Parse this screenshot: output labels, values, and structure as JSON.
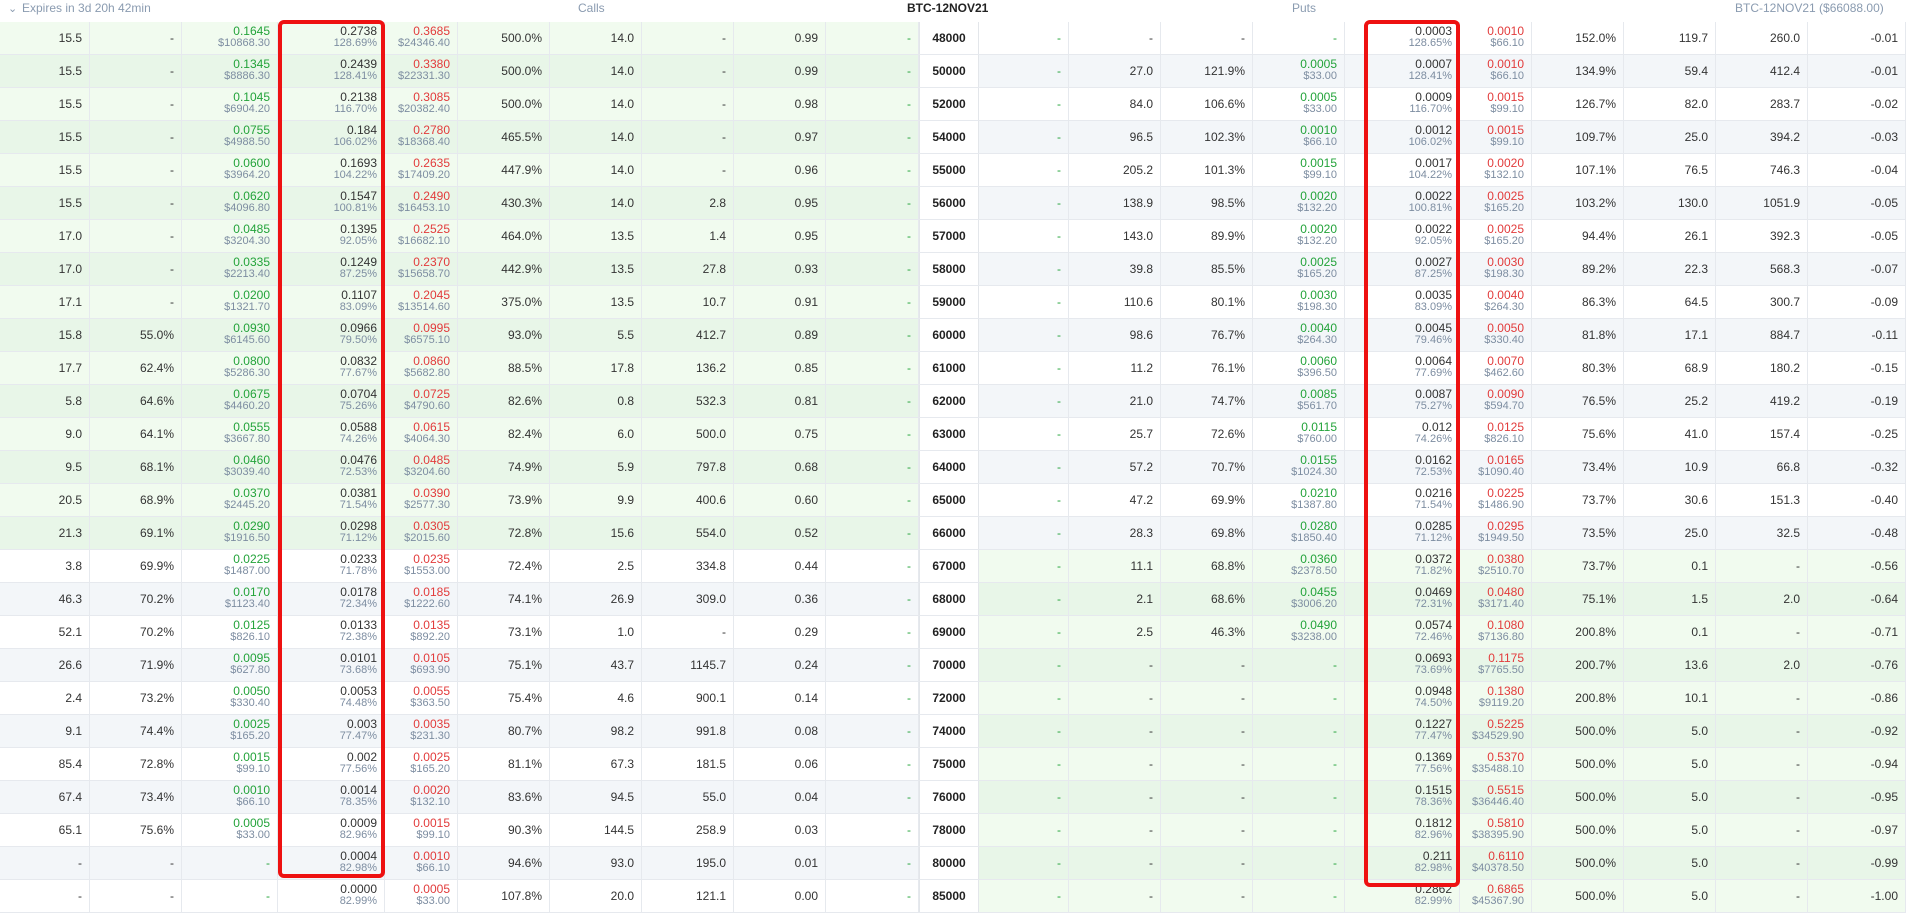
{
  "header": {
    "expiry": "Expires in 3d 20h 42min",
    "calls": "Calls",
    "instrument": "BTC-12NOV21",
    "puts": "Puts",
    "right": "BTC-12NOV21 ($66088.00)"
  },
  "icons": {
    "collapse": "chevron-down-icon"
  },
  "colors": {
    "bid": "#23a33a",
    "ask": "#e23b3b",
    "highlight": "#ee1111",
    "itm_background": "#f1fbef"
  },
  "rows": [
    {
      "strike": "48000",
      "call_itm": true,
      "put_itm": false,
      "call": [
        "15.5",
        "-",
        "0.1645",
        "$10868.30",
        "0.2738",
        "128.69%",
        "0.3685",
        "$24346.40",
        "500.0%",
        "14.0",
        "-",
        "0.99",
        "-"
      ],
      "put": [
        "-",
        "-",
        "-",
        "-",
        "0.0003",
        "128.65%",
        "0.0010",
        "$66.10",
        "152.0%",
        "119.7",
        "260.0",
        "-0.01"
      ]
    },
    {
      "strike": "50000",
      "call_itm": true,
      "put_itm": false,
      "call": [
        "15.5",
        "-",
        "0.1345",
        "$8886.30",
        "0.2439",
        "128.41%",
        "0.3380",
        "$22331.30",
        "500.0%",
        "14.0",
        "-",
        "0.99",
        "-"
      ],
      "put": [
        "-",
        "27.0",
        "121.9%",
        "0.0005",
        "$33.00",
        "0.0007",
        "128.41%",
        "0.0010",
        "$66.10",
        "134.9%",
        "59.4",
        "412.4",
        "-0.01"
      ]
    },
    {
      "strike": "52000",
      "call_itm": true,
      "put_itm": false,
      "call": [
        "15.5",
        "-",
        "0.1045",
        "$6904.20",
        "0.2138",
        "116.70%",
        "0.3085",
        "$20382.40",
        "500.0%",
        "14.0",
        "-",
        "0.98",
        "-"
      ],
      "put": [
        "-",
        "84.0",
        "106.6%",
        "0.0005",
        "$33.00",
        "0.0009",
        "116.70%",
        "0.0015",
        "$99.10",
        "126.7%",
        "82.0",
        "283.7",
        "-0.02"
      ]
    },
    {
      "strike": "54000",
      "call_itm": true,
      "put_itm": false,
      "call": [
        "15.5",
        "-",
        "0.0755",
        "$4988.50",
        "0.184",
        "106.02%",
        "0.2780",
        "$18368.40",
        "465.5%",
        "14.0",
        "-",
        "0.97",
        "-"
      ],
      "put": [
        "-",
        "96.5",
        "102.3%",
        "0.0010",
        "$66.10",
        "0.0012",
        "106.02%",
        "0.0015",
        "$99.10",
        "109.7%",
        "25.0",
        "394.2",
        "-0.03"
      ]
    },
    {
      "strike": "55000",
      "call_itm": true,
      "put_itm": false,
      "call": [
        "15.5",
        "-",
        "0.0600",
        "$3964.20",
        "0.1693",
        "104.22%",
        "0.2635",
        "$17409.20",
        "447.9%",
        "14.0",
        "-",
        "0.96",
        "-"
      ],
      "put": [
        "-",
        "205.2",
        "101.3%",
        "0.0015",
        "$99.10",
        "0.0017",
        "104.22%",
        "0.0020",
        "$132.10",
        "107.1%",
        "76.5",
        "746.3",
        "-0.04"
      ]
    },
    {
      "strike": "56000",
      "call_itm": true,
      "put_itm": false,
      "call": [
        "15.5",
        "-",
        "0.0620",
        "$4096.80",
        "0.1547",
        "100.81%",
        "0.2490",
        "$16453.10",
        "430.3%",
        "14.0",
        "2.8",
        "0.95",
        "-"
      ],
      "put": [
        "-",
        "138.9",
        "98.5%",
        "0.0020",
        "$132.20",
        "0.0022",
        "100.81%",
        "0.0025",
        "$165.20",
        "103.2%",
        "130.0",
        "1051.9",
        "-0.05"
      ]
    },
    {
      "strike": "57000",
      "call_itm": true,
      "put_itm": false,
      "call": [
        "17.0",
        "-",
        "0.0485",
        "$3204.30",
        "0.1395",
        "92.05%",
        "0.2525",
        "$16682.10",
        "464.0%",
        "13.5",
        "1.4",
        "0.95",
        "-"
      ],
      "put": [
        "-",
        "143.0",
        "89.9%",
        "0.0020",
        "$132.20",
        "0.0022",
        "92.05%",
        "0.0025",
        "$165.20",
        "94.4%",
        "26.1",
        "392.3",
        "-0.05"
      ]
    },
    {
      "strike": "58000",
      "call_itm": true,
      "put_itm": false,
      "call": [
        "17.0",
        "-",
        "0.0335",
        "$2213.40",
        "0.1249",
        "87.25%",
        "0.2370",
        "$15658.70",
        "442.9%",
        "13.5",
        "27.8",
        "0.93",
        "-"
      ],
      "put": [
        "-",
        "39.8",
        "85.5%",
        "0.0025",
        "$165.20",
        "0.0027",
        "87.25%",
        "0.0030",
        "$198.30",
        "89.2%",
        "22.3",
        "568.3",
        "-0.07"
      ]
    },
    {
      "strike": "59000",
      "call_itm": true,
      "put_itm": false,
      "call": [
        "17.1",
        "-",
        "0.0200",
        "$1321.70",
        "0.1107",
        "83.09%",
        "0.2045",
        "$13514.60",
        "375.0%",
        "13.5",
        "10.7",
        "0.91",
        "-"
      ],
      "put": [
        "-",
        "110.6",
        "80.1%",
        "0.0030",
        "$198.30",
        "0.0035",
        "83.09%",
        "0.0040",
        "$264.30",
        "86.3%",
        "64.5",
        "300.7",
        "-0.09"
      ]
    },
    {
      "strike": "60000",
      "call_itm": true,
      "put_itm": false,
      "call": [
        "15.8",
        "55.0%",
        "0.0930",
        "$6145.60",
        "0.0966",
        "79.50%",
        "0.0995",
        "$6575.10",
        "93.0%",
        "5.5",
        "412.7",
        "0.89",
        "-"
      ],
      "put": [
        "-",
        "98.6",
        "76.7%",
        "0.0040",
        "$264.30",
        "0.0045",
        "79.46%",
        "0.0050",
        "$330.40",
        "81.8%",
        "17.1",
        "884.7",
        "-0.11"
      ]
    },
    {
      "strike": "61000",
      "call_itm": true,
      "put_itm": false,
      "call": [
        "17.7",
        "62.4%",
        "0.0800",
        "$5286.30",
        "0.0832",
        "77.67%",
        "0.0860",
        "$5682.80",
        "88.5%",
        "17.8",
        "136.2",
        "0.85",
        "-"
      ],
      "put": [
        "-",
        "11.2",
        "76.1%",
        "0.0060",
        "$396.50",
        "0.0064",
        "77.69%",
        "0.0070",
        "$462.60",
        "80.3%",
        "68.9",
        "180.2",
        "-0.15"
      ]
    },
    {
      "strike": "62000",
      "call_itm": true,
      "put_itm": false,
      "call": [
        "5.8",
        "64.6%",
        "0.0675",
        "$4460.20",
        "0.0704",
        "75.26%",
        "0.0725",
        "$4790.60",
        "82.6%",
        "0.8",
        "532.3",
        "0.81",
        "-"
      ],
      "put": [
        "-",
        "21.0",
        "74.7%",
        "0.0085",
        "$561.70",
        "0.0087",
        "75.27%",
        "0.0090",
        "$594.70",
        "76.5%",
        "25.2",
        "419.2",
        "-0.19"
      ]
    },
    {
      "strike": "63000",
      "call_itm": true,
      "put_itm": false,
      "call": [
        "9.0",
        "64.1%",
        "0.0555",
        "$3667.80",
        "0.0588",
        "74.26%",
        "0.0615",
        "$4064.30",
        "82.4%",
        "6.0",
        "500.0",
        "0.75",
        "-"
      ],
      "put": [
        "-",
        "25.7",
        "72.6%",
        "0.0115",
        "$760.00",
        "0.012",
        "74.26%",
        "0.0125",
        "$826.10",
        "75.6%",
        "41.0",
        "157.4",
        "-0.25"
      ]
    },
    {
      "strike": "64000",
      "call_itm": true,
      "put_itm": false,
      "call": [
        "9.5",
        "68.1%",
        "0.0460",
        "$3039.40",
        "0.0476",
        "72.53%",
        "0.0485",
        "$3204.60",
        "74.9%",
        "5.9",
        "797.8",
        "0.68",
        "-"
      ],
      "put": [
        "-",
        "57.2",
        "70.7%",
        "0.0155",
        "$1024.30",
        "0.0162",
        "72.53%",
        "0.0165",
        "$1090.40",
        "73.4%",
        "10.9",
        "66.8",
        "-0.32"
      ]
    },
    {
      "strike": "65000",
      "call_itm": true,
      "put_itm": false,
      "call": [
        "20.5",
        "68.9%",
        "0.0370",
        "$2445.20",
        "0.0381",
        "71.54%",
        "0.0390",
        "$2577.30",
        "73.9%",
        "9.9",
        "400.6",
        "0.60",
        "-"
      ],
      "put": [
        "-",
        "47.2",
        "69.9%",
        "0.0210",
        "$1387.80",
        "0.0216",
        "71.54%",
        "0.0225",
        "$1486.90",
        "73.7%",
        "30.6",
        "151.3",
        "-0.40"
      ]
    },
    {
      "strike": "66000",
      "call_itm": true,
      "put_itm": false,
      "call": [
        "21.3",
        "69.1%",
        "0.0290",
        "$1916.50",
        "0.0298",
        "71.12%",
        "0.0305",
        "$2015.60",
        "72.8%",
        "15.6",
        "554.0",
        "0.52",
        "-"
      ],
      "put": [
        "-",
        "28.3",
        "69.8%",
        "0.0280",
        "$1850.40",
        "0.0285",
        "71.12%",
        "0.0295",
        "$1949.50",
        "73.5%",
        "25.0",
        "32.5",
        "-0.48"
      ]
    },
    {
      "strike": "67000",
      "call_itm": false,
      "put_itm": true,
      "call": [
        "3.8",
        "69.9%",
        "0.0225",
        "$1487.00",
        "0.0233",
        "71.78%",
        "0.0235",
        "$1553.00",
        "72.4%",
        "2.5",
        "334.8",
        "0.44",
        "-"
      ],
      "put": [
        "-",
        "11.1",
        "68.8%",
        "0.0360",
        "$2378.50",
        "0.0372",
        "71.82%",
        "0.0380",
        "$2510.70",
        "73.7%",
        "0.1",
        "-",
        "-0.56"
      ]
    },
    {
      "strike": "68000",
      "call_itm": false,
      "put_itm": true,
      "call": [
        "46.3",
        "70.2%",
        "0.0170",
        "$1123.40",
        "0.0178",
        "72.34%",
        "0.0185",
        "$1222.60",
        "74.1%",
        "26.9",
        "309.0",
        "0.36",
        "-"
      ],
      "put": [
        "-",
        "2.1",
        "68.6%",
        "0.0455",
        "$3006.20",
        "0.0469",
        "72.31%",
        "0.0480",
        "$3171.40",
        "75.1%",
        "1.5",
        "2.0",
        "-0.64"
      ]
    },
    {
      "strike": "69000",
      "call_itm": false,
      "put_itm": true,
      "call": [
        "52.1",
        "70.2%",
        "0.0125",
        "$826.10",
        "0.0133",
        "72.38%",
        "0.0135",
        "$892.20",
        "73.1%",
        "1.0",
        "-",
        "0.29",
        "-"
      ],
      "put": [
        "-",
        "2.5",
        "46.3%",
        "0.0490",
        "$3238.00",
        "0.0574",
        "72.46%",
        "0.1080",
        "$7136.80",
        "200.8%",
        "0.1",
        "-",
        "-0.71"
      ]
    },
    {
      "strike": "70000",
      "call_itm": false,
      "put_itm": true,
      "call": [
        "26.6",
        "71.9%",
        "0.0095",
        "$627.80",
        "0.0101",
        "73.68%",
        "0.0105",
        "$693.90",
        "75.1%",
        "43.7",
        "1145.7",
        "0.24",
        "-"
      ],
      "put": [
        "-",
        "-",
        "-",
        "-",
        "0.0693",
        "73.69%",
        "0.1175",
        "$7765.50",
        "200.7%",
        "13.6",
        "2.0",
        "-0.76"
      ]
    },
    {
      "strike": "72000",
      "call_itm": false,
      "put_itm": true,
      "call": [
        "2.4",
        "73.2%",
        "0.0050",
        "$330.40",
        "0.0053",
        "74.48%",
        "0.0055",
        "$363.50",
        "75.4%",
        "4.6",
        "900.1",
        "0.14",
        "-"
      ],
      "put": [
        "-",
        "-",
        "-",
        "-",
        "0.0948",
        "74.50%",
        "0.1380",
        "$9119.20",
        "200.8%",
        "10.1",
        "-",
        "-0.86"
      ]
    },
    {
      "strike": "74000",
      "call_itm": false,
      "put_itm": true,
      "call": [
        "9.1",
        "74.4%",
        "0.0025",
        "$165.20",
        "0.003",
        "77.47%",
        "0.0035",
        "$231.30",
        "80.7%",
        "98.2",
        "991.8",
        "0.08",
        "-"
      ],
      "put": [
        "-",
        "-",
        "-",
        "-",
        "0.1227",
        "77.47%",
        "0.5225",
        "$34529.90",
        "500.0%",
        "5.0",
        "-",
        "-0.92"
      ]
    },
    {
      "strike": "75000",
      "call_itm": false,
      "put_itm": true,
      "call": [
        "85.4",
        "72.8%",
        "0.0015",
        "$99.10",
        "0.002",
        "77.56%",
        "0.0025",
        "$165.20",
        "81.1%",
        "67.3",
        "181.5",
        "0.06",
        "-"
      ],
      "put": [
        "-",
        "-",
        "-",
        "-",
        "0.1369",
        "77.56%",
        "0.5370",
        "$35488.10",
        "500.0%",
        "5.0",
        "-",
        "-0.94"
      ]
    },
    {
      "strike": "76000",
      "call_itm": false,
      "put_itm": true,
      "call": [
        "67.4",
        "73.4%",
        "0.0010",
        "$66.10",
        "0.0014",
        "78.35%",
        "0.0020",
        "$132.10",
        "83.6%",
        "94.5",
        "55.0",
        "0.04",
        "-"
      ],
      "put": [
        "-",
        "-",
        "-",
        "-",
        "0.1515",
        "78.36%",
        "0.5515",
        "$36446.40",
        "500.0%",
        "5.0",
        "-",
        "-0.95"
      ]
    },
    {
      "strike": "78000",
      "call_itm": false,
      "put_itm": true,
      "call": [
        "65.1",
        "75.6%",
        "0.0005",
        "$33.00",
        "0.0009",
        "82.96%",
        "0.0015",
        "$99.10",
        "90.3%",
        "144.5",
        "258.9",
        "0.03",
        "-"
      ],
      "put": [
        "-",
        "-",
        "-",
        "-",
        "0.1812",
        "82.96%",
        "0.5810",
        "$38395.90",
        "500.0%",
        "5.0",
        "-",
        "-0.97"
      ]
    },
    {
      "strike": "80000",
      "call_itm": false,
      "put_itm": true,
      "call": [
        "-",
        "-",
        "-",
        "-",
        "0.0004",
        "82.98%",
        "0.0010",
        "$66.10",
        "94.6%",
        "93.0",
        "195.0",
        "0.01",
        "-"
      ],
      "put": [
        "-",
        "-",
        "-",
        "-",
        "0.211",
        "82.98%",
        "0.6110",
        "$40378.50",
        "500.0%",
        "5.0",
        "-",
        "-0.99"
      ]
    },
    {
      "strike": "85000",
      "call_itm": false,
      "put_itm": true,
      "call": [
        "-",
        "-",
        "-",
        "-",
        "0.0000",
        "82.99%",
        "0.0005",
        "$33.00",
        "107.8%",
        "20.0",
        "121.1",
        "0.00",
        "-"
      ],
      "put": [
        "-",
        "-",
        "-",
        "-",
        "0.2862",
        "82.99%",
        "0.6865",
        "$45367.90",
        "500.0%",
        "5.0",
        "-",
        "-1.00"
      ]
    }
  ]
}
